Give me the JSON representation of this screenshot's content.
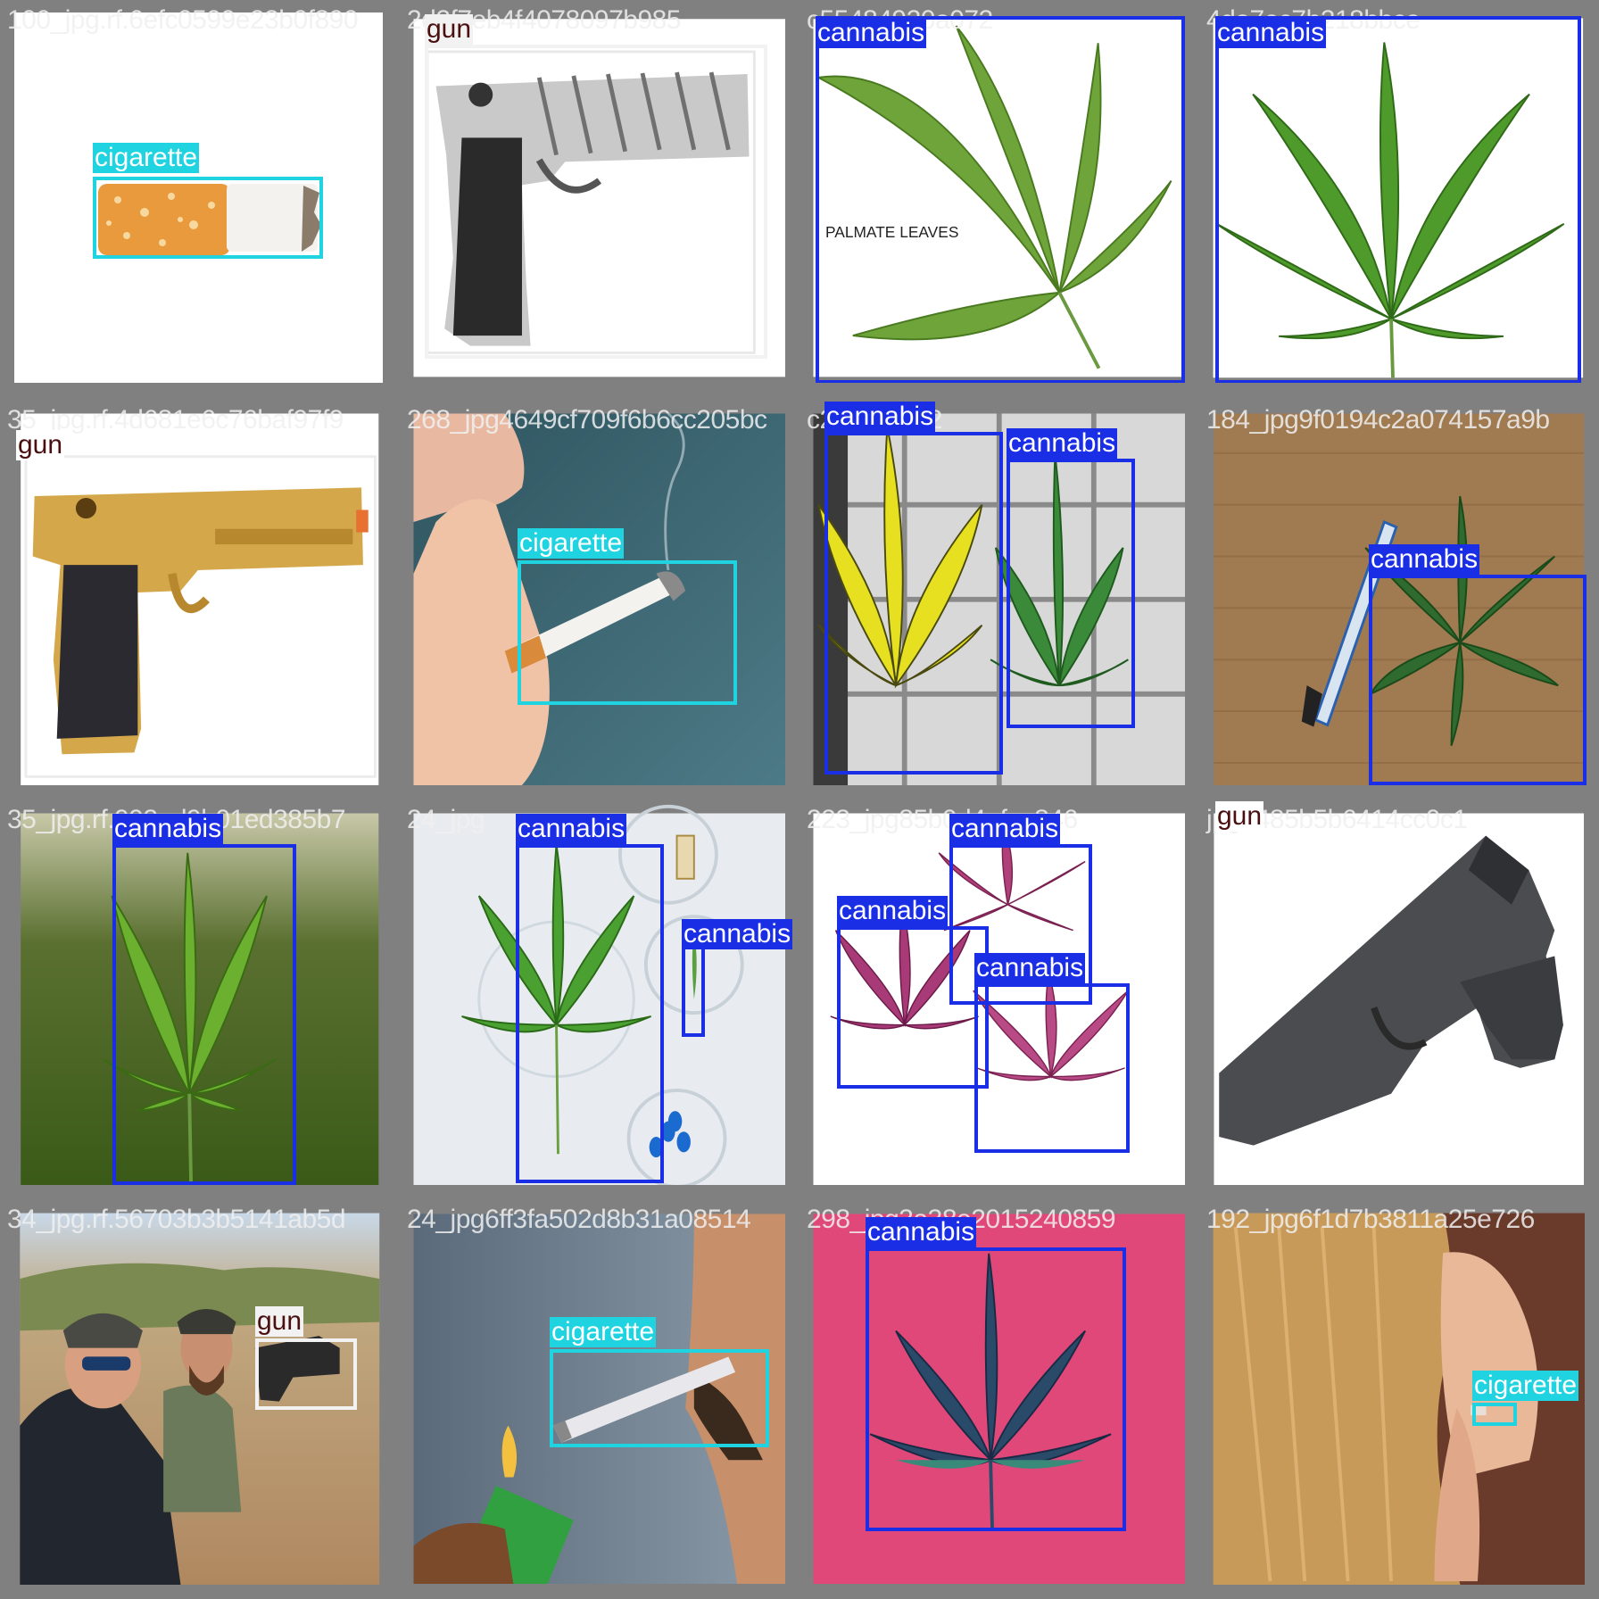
{
  "colors": {
    "cannabis": "#1a2ee6",
    "cigarette": "#1fd3e0",
    "gun": "#f2f2f2",
    "gun_text": "#4a1010"
  },
  "tiles": [
    {
      "filename": "100_jpg.rf.6efc0599e23b0f890",
      "detections": [
        {
          "label": "cigarette"
        }
      ],
      "icon": "cigarette-butt"
    },
    {
      "filename": "2d2f7eb4f4078097b985",
      "detections": [
        {
          "label": "gun"
        }
      ],
      "icon": "pistol-silver"
    },
    {
      "filename": "c55484920a072",
      "detections": [
        {
          "label": "cannabis"
        }
      ],
      "icon": "cannabis-leaf",
      "caption": "PALMATE LEAVES"
    },
    {
      "filename": "4da7ec7b218bbce",
      "detections": [
        {
          "label": "cannabis"
        }
      ],
      "icon": "cannabis-leaf"
    },
    {
      "filename": "35_jpg.rf.4d681e6c76baf97f9",
      "detections": [
        {
          "label": "gun"
        }
      ],
      "icon": "pistol-gold"
    },
    {
      "filename": "268_jpg4649cf709f6b6cc205bc",
      "detections": [
        {
          "label": "cigarette"
        }
      ],
      "icon": "smoking-hand"
    },
    {
      "filename": "c23af5b212",
      "detections": [
        {
          "label": "cannabis"
        },
        {
          "label": "cannabis"
        }
      ],
      "icon": "cannabis-leaves-tile"
    },
    {
      "filename": "184_jpg9f0194c2a074157a9b",
      "detections": [
        {
          "label": "cannabis"
        }
      ],
      "icon": "cannabis-leaf-burlap"
    },
    {
      "filename": "35_jpg.rf.993ad9b01ed385b7",
      "detections": [
        {
          "label": "cannabis"
        }
      ],
      "icon": "cannabis-leaf-field"
    },
    {
      "filename": "24_jpg",
      "detections": [
        {
          "label": "cannabis"
        },
        {
          "label": "cannabis"
        }
      ],
      "icon": "cannabis-leaf-petri"
    },
    {
      "filename": "223_jpg85b0d4afce846",
      "detections": [
        {
          "label": "cannabis"
        },
        {
          "label": "cannabis"
        },
        {
          "label": "cannabis"
        }
      ],
      "icon": "cannabis-leaves-pink"
    },
    {
      "filename": "jpg7485b5b6414cc0c1",
      "detections": [
        {
          "label": "gun"
        }
      ],
      "icon": "pistol-black"
    },
    {
      "filename": "34_jpg.rf.56703b3b5141ab5d",
      "detections": [
        {
          "label": "gun"
        }
      ],
      "icon": "shooters"
    },
    {
      "filename": "24_jpg6ff3fa502d8b31a08514",
      "detections": [
        {
          "label": "cigarette"
        }
      ],
      "icon": "lighting-cigarette"
    },
    {
      "filename": "298_jpg3a38e2015240859",
      "detections": [
        {
          "label": "cannabis"
        }
      ],
      "icon": "cannabis-leaf-pink-bg"
    },
    {
      "filename": "192_jpg6f1d7b3811a25e726",
      "detections": [
        {
          "label": "cigarette"
        }
      ],
      "icon": "woman-smoking"
    }
  ]
}
